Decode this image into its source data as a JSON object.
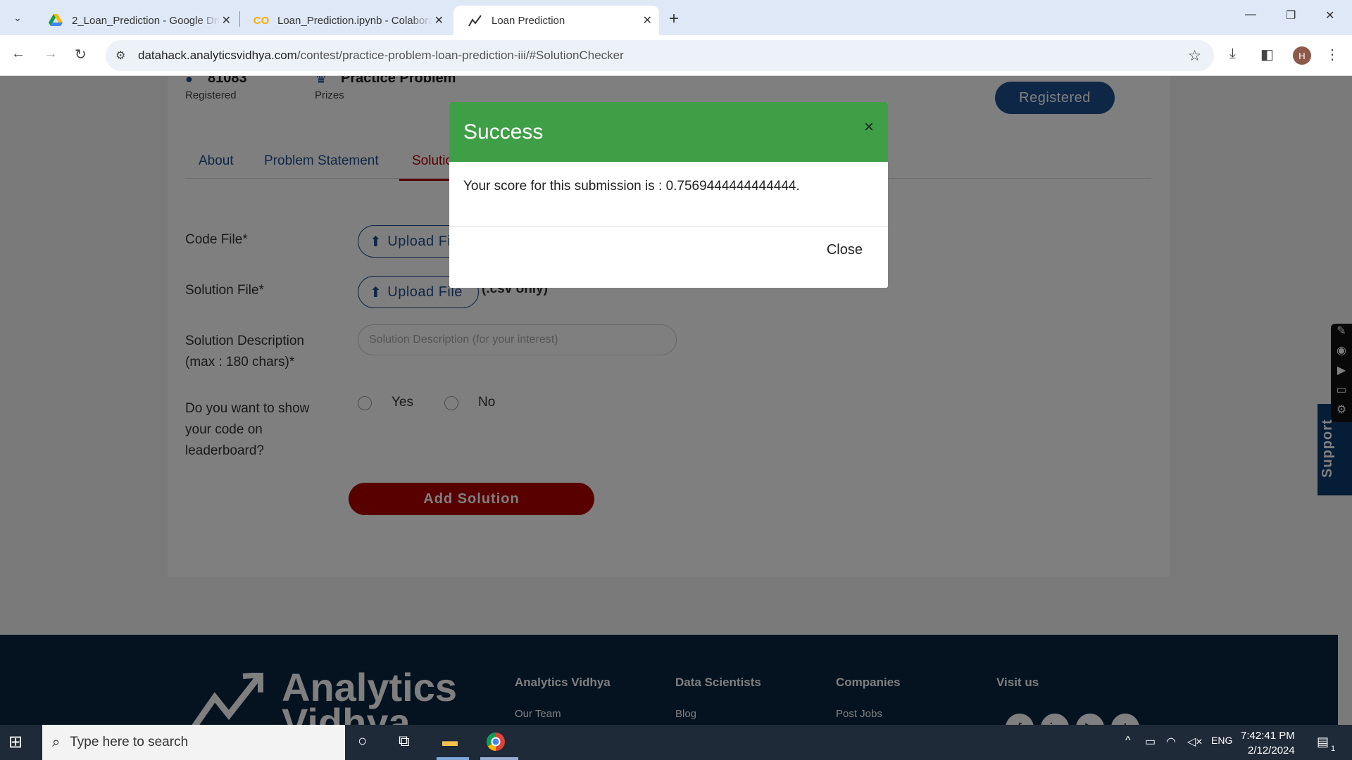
{
  "browser": {
    "tabs": [
      {
        "title": "2_Loan_Prediction - Google Drive",
        "icon": "google-drive-icon"
      },
      {
        "title": "Loan_Prediction.ipynb - Colaboratory",
        "icon": "colab-icon"
      },
      {
        "title": "Loan Prediction",
        "icon": "analytics-vidhya-icon"
      }
    ],
    "url_main": "datahack.analyticsvidhya.com",
    "url_path": "/contest/practice-problem-loan-prediction-iii/#SolutionChecker",
    "profile_initial": "H"
  },
  "contest": {
    "registered_count": "81083",
    "registered_label": "Registered",
    "prize_value": "Practice Problem",
    "prize_label": "Prizes",
    "register_button": "Registered"
  },
  "tabs": {
    "about": "About",
    "problem_statement": "Problem Statement",
    "solution": "Solution Checker"
  },
  "form": {
    "code_file_label": "Code File*",
    "upload_label": "Upload File",
    "solution_file_label": "Solution File*",
    "csv_note": "(.csv only)",
    "desc_label_1": "Solution Description",
    "desc_label_2": "(max : 180 chars)*",
    "desc_placeholder": "Solution Description (for your interest)",
    "show_code_1": "Do you want to show",
    "show_code_2": "your code on",
    "show_code_3": "leaderboard?",
    "yes": "Yes",
    "no": "No",
    "submit": "Add Solution"
  },
  "modal": {
    "title": "Success",
    "close_x": "×",
    "message": "Your score for this submission is : 0.7569444444444444.",
    "close_button": "Close",
    "header_color": "#3f9f46"
  },
  "footer": {
    "logo_line1": "Analytics",
    "logo_line2": "Vidhya",
    "col1": "Analytics Vidhya",
    "col1_link": "Our Team",
    "col2": "Data Scientists",
    "col2_link": "Blog",
    "col3": "Companies",
    "col3_link": "Post Jobs",
    "col4": "Visit us",
    "social": [
      "f",
      "in",
      "▶",
      "t"
    ]
  },
  "support": "Support",
  "taskbar": {
    "search_placeholder": "Type here to search",
    "language": "ENG",
    "time": "7:42:41 PM",
    "date": "2/12/2024",
    "notifications": "1"
  }
}
